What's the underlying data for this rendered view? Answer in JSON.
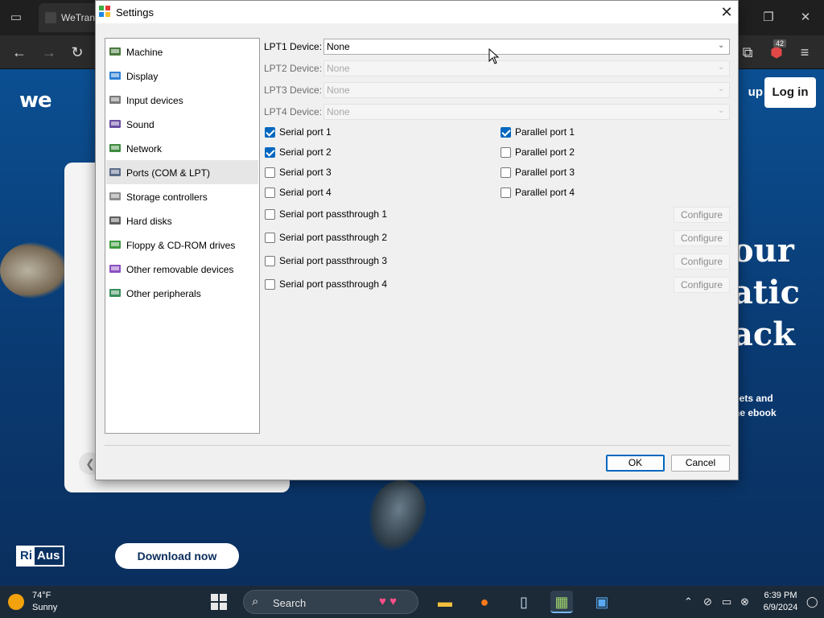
{
  "browser": {
    "tab_title": "WeTran",
    "site": {
      "signup_label": "up",
      "login_label": "Log in",
      "hero_lines": [
        "our",
        "atic",
        "ack"
      ],
      "hero_sub_lines": [
        "eets and",
        "he ebook"
      ],
      "download_label": "Download now",
      "riaus_ri": "Ri",
      "riaus_aus": "Aus",
      "extension_badge": "42"
    }
  },
  "dialog": {
    "title": "Settings",
    "nav": [
      {
        "label": "Machine",
        "icon": "machine-icon"
      },
      {
        "label": "Display",
        "icon": "display-icon"
      },
      {
        "label": "Input devices",
        "icon": "input-devices-icon"
      },
      {
        "label": "Sound",
        "icon": "sound-icon"
      },
      {
        "label": "Network",
        "icon": "network-icon"
      },
      {
        "label": "Ports (COM & LPT)",
        "icon": "ports-icon",
        "selected": true
      },
      {
        "label": "Storage controllers",
        "icon": "storage-icon"
      },
      {
        "label": "Hard disks",
        "icon": "hard-disk-icon"
      },
      {
        "label": "Floppy & CD-ROM drives",
        "icon": "floppy-cdrom-icon"
      },
      {
        "label": "Other removable devices",
        "icon": "removable-icon"
      },
      {
        "label": "Other peripherals",
        "icon": "peripherals-icon"
      }
    ],
    "lpt": [
      {
        "label": "LPT1 Device:",
        "value": "None",
        "enabled": true
      },
      {
        "label": "LPT2 Device:",
        "value": "None",
        "enabled": false
      },
      {
        "label": "LPT3 Device:",
        "value": "None",
        "enabled": false
      },
      {
        "label": "LPT4 Device:",
        "value": "None",
        "enabled": false
      }
    ],
    "serial_ports": [
      {
        "label": "Serial port 1",
        "checked": true
      },
      {
        "label": "Serial port 2",
        "checked": true
      },
      {
        "label": "Serial port 3",
        "checked": false
      },
      {
        "label": "Serial port 4",
        "checked": false
      }
    ],
    "parallel_ports": [
      {
        "label": "Parallel port 1",
        "checked": true
      },
      {
        "label": "Parallel port 2",
        "checked": false
      },
      {
        "label": "Parallel port 3",
        "checked": false
      },
      {
        "label": "Parallel port 4",
        "checked": false
      }
    ],
    "passthrough": [
      {
        "label": "Serial port passthrough 1",
        "checked": false,
        "button": "Configure"
      },
      {
        "label": "Serial port passthrough 2",
        "checked": false,
        "button": "Configure"
      },
      {
        "label": "Serial port passthrough 3",
        "checked": false,
        "button": "Configure"
      },
      {
        "label": "Serial port passthrough 4",
        "checked": false,
        "button": "Configure"
      }
    ],
    "ok_label": "OK",
    "cancel_label": "Cancel",
    "colors": {
      "accent": "#0067c0",
      "selected_row": "#e6e6e6"
    }
  },
  "taskbar": {
    "temperature": "74°F",
    "condition": "Sunny",
    "search_label": "Search",
    "time": "6:39 PM",
    "date": "6/9/2024"
  }
}
